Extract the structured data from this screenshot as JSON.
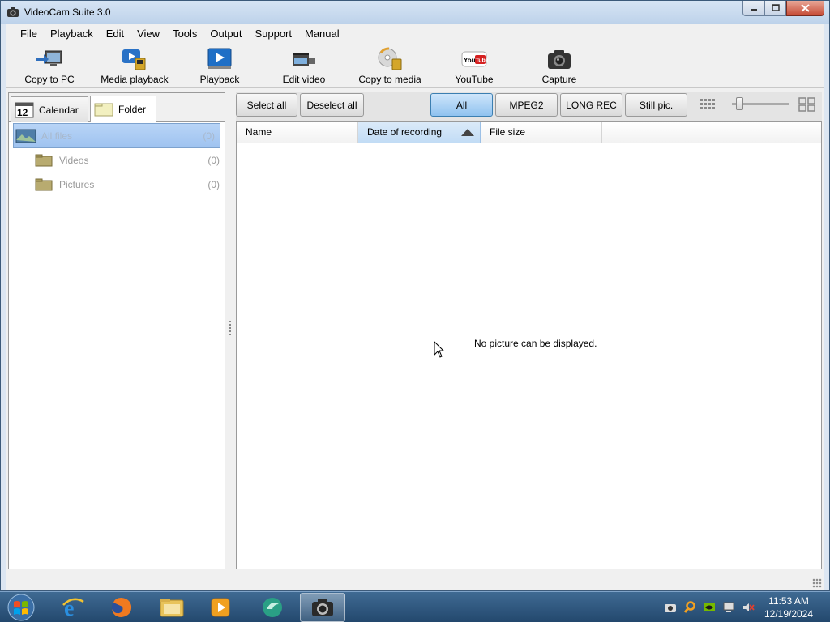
{
  "window": {
    "title": "VideoCam Suite 3.0"
  },
  "menu": [
    "File",
    "Playback",
    "Edit",
    "View",
    "Tools",
    "Output",
    "Support",
    "Manual"
  ],
  "toolbar": {
    "copy_to_pc": "Copy to PC",
    "media_playback": "Media playback",
    "playback": "Playback",
    "edit_video": "Edit video",
    "copy_to_media": "Copy to media",
    "youtube": "YouTube",
    "capture": "Capture"
  },
  "tabs": {
    "calendar_num": "12",
    "calendar": "Calendar",
    "folder": "Folder"
  },
  "tree": [
    {
      "label": "All files",
      "count": "(0)"
    },
    {
      "label": "Videos",
      "count": "(0)"
    },
    {
      "label": "Pictures",
      "count": "(0)"
    }
  ],
  "actions": {
    "select_all": "Select all",
    "deselect_all": "Deselect all"
  },
  "filters": {
    "all": "All",
    "mpeg2": "MPEG2",
    "long_rec": "LONG REC",
    "still": "Still pic."
  },
  "columns": {
    "name": "Name",
    "date": "Date of recording",
    "size": "File size"
  },
  "empty_message": "No picture can be displayed.",
  "clock": {
    "time": "11:53 AM",
    "date": "12/19/2024"
  }
}
